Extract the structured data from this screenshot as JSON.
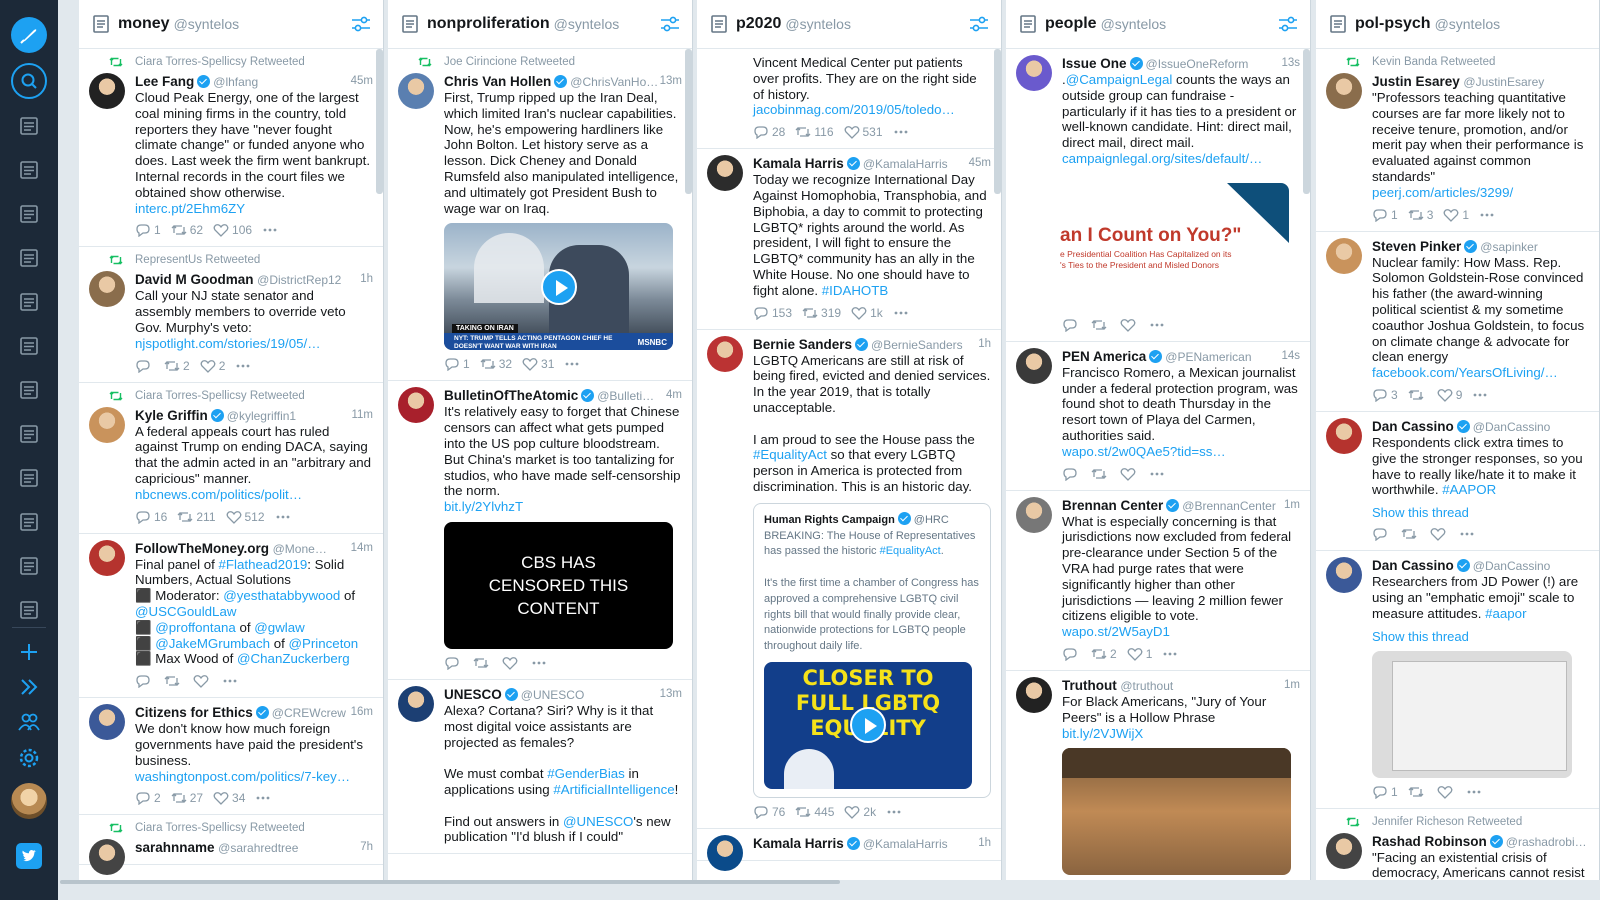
{
  "colors": {
    "accent": "#1da1f2",
    "sidebar": "#1c2938",
    "retweet": "#17bf63"
  },
  "columns": [
    {
      "num": "11",
      "name": "money",
      "account": "@syntelos",
      "tweets": [
        {
          "rt": "Ciara Torres-Spellicsy Retweeted",
          "name": "Lee Fang",
          "verified": true,
          "handle": "@lhfang",
          "time": "45m",
          "text": "Cloud Peak Energy, one of the largest coal mining firms in the country, told reporters they have \"never fought climate change\" or funded anyone who does. Last week the firm went bankrupt. Internal records in the court files we obtained show otherwise.",
          "link": "interc.pt/2Ehm6ZY",
          "replies": "1",
          "retweets": "62",
          "likes": "106"
        },
        {
          "rt": "RepresentUs Retweeted",
          "name": "David M Goodman",
          "verified": false,
          "handle": "@DistrictRep12",
          "time": "1h",
          "text": "Call your NJ state senator and assembly members to override veto Gov. Murphy's veto:",
          "link": "njspotlight.com/stories/19/05/…",
          "replies": "",
          "retweets": "2",
          "likes": "2"
        },
        {
          "rt": "Ciara Torres-Spellicsy Retweeted",
          "name": "Kyle Griffin",
          "verified": true,
          "handle": "@kylegriffin1",
          "time": "11m",
          "text": "A federal appeals court has ruled against Trump on ending DACA, saying that the admin acted in an \"arbitrary and capricious\" manner.",
          "link": "nbcnews.com/politics/polit…",
          "replies": "16",
          "retweets": "211",
          "likes": "512"
        },
        {
          "rt": "",
          "name": "FollowTheMoney.org",
          "verified": false,
          "handle": "@Mone…",
          "time": "14m",
          "text": "Final panel of #Flathead2019: Solid Numbers, Actual Solutions\n⬛ Moderator: @yesthatabbywood of @USCGouldLaw\n⬛ @proffontana of @gwlaw\n⬛ @JakeMGrumbach of @Princeton\n⬛ Max Wood of @ChanZuckerberg",
          "link": "",
          "replies": "",
          "retweets": "",
          "likes": ""
        },
        {
          "rt": "",
          "name": "Citizens for Ethics",
          "verified": true,
          "handle": "@CREWcrew",
          "time": "16m",
          "text": "We don't know how much foreign governments have paid the president's business.",
          "link": "washingtonpost.com/politics/7-key…",
          "replies": "2",
          "retweets": "27",
          "likes": "34"
        },
        {
          "rt": "Ciara Torres-Spellicsy Retweeted",
          "name": "sarahnname",
          "verified": false,
          "handle": "@sarahredtree",
          "time": "7h",
          "text": "",
          "link": "",
          "replies": "",
          "retweets": "",
          "likes": ""
        }
      ]
    },
    {
      "num": "12",
      "name": "nonproliferation",
      "account": "@syntelos",
      "tweets": [
        {
          "rt": "Joe Cirincione Retweeted",
          "name": "Chris Van Hollen",
          "verified": true,
          "handle": "@ChrisVanHo…",
          "time": "13m",
          "text": "First, Trump ripped up the Iran Deal, which limited Iran's nuclear capabilities. Now, he's empowering hardliners like John Bolton. Let history serve as a lesson. Dick Cheney and Donald Rumsfeld also manipulated intelligence, and ultimately got President Bush to wage war on Iraq.",
          "link": "",
          "media_caption": "TAKING ON IRAN",
          "media_ticker": "NYT: TRUMP TELLS ACTING PENTAGON CHIEF HE DOESN'T WANT WAR WITH IRAN",
          "media_brand": "MSNBC",
          "replies": "1",
          "retweets": "32",
          "likes": "31"
        },
        {
          "rt": "",
          "name": "BulletinOfTheAtomic",
          "verified": true,
          "handle": "@Bulleti…",
          "time": "4m",
          "text": "It's relatively easy to forget that Chinese censors can affect what gets pumped into the US pop culture bloodstream. But China's market is too tantalizing for studios, who have made self-censorship the norm.",
          "link": "bit.ly/2YlvhzT",
          "media_text": "CBS HAS CENSORED THIS CONTENT",
          "replies": "",
          "retweets": "",
          "likes": ""
        },
        {
          "rt": "",
          "name": "UNESCO",
          "verified": true,
          "handle": "@UNESCO",
          "time": "13m",
          "text": "Alexa? Cortana? Siri? Why is it that most digital voice assistants are projected as females?\n\nWe must combat #GenderBias in applications using #ArtificialIntelligence!\n\nFind out answers in @UNESCO's new publication \"I'd blush if I could\"",
          "link": "",
          "replies": "",
          "retweets": "",
          "likes": ""
        }
      ]
    },
    {
      "num": "13",
      "name": "p2020",
      "account": "@syntelos",
      "tweets": [
        {
          "rt": "",
          "name": "",
          "verified": false,
          "handle": "",
          "time": "",
          "text": "Vincent Medical Center put patients over profits. They are on the right side of history.",
          "link": "jacobinmag.com/2019/05/toledo…",
          "replies": "28",
          "retweets": "116",
          "likes": "531"
        },
        {
          "rt": "",
          "name": "Kamala Harris",
          "verified": true,
          "handle": "@KamalaHarris",
          "time": "45m",
          "text": "Today we recognize International Day Against Homophobia, Transphobia, and Biphobia, a day to commit to protecting LGBTQ* rights around the world. As president, I will fight to ensure the LGBTQ* community has an ally in the White House. No one should have to fight alone. #IDAHOTB",
          "link": "",
          "replies": "153",
          "retweets": "319",
          "likes": "1k"
        },
        {
          "rt": "",
          "name": "Bernie Sanders",
          "verified": true,
          "handle": "@BernieSanders",
          "time": "1h",
          "text": "LGBTQ Americans are still at risk of being fired, evicted and denied services. In the year 2019, that is totally unacceptable.\n\nI am proud to see the House pass the #EqualityAct so that every LGBTQ person in America is protected from discrimination. This is an historic day.",
          "link": "",
          "quote_name": "Human Rights Campaign",
          "quote_handle": "@HRC",
          "quote_text": "BREAKING: The House of Representatives has passed the historic #EqualityAct.\n\nIt's the first time a chamber of Congress has approved a comprehensive LGBTQ civil rights bill that would finally provide clear, nationwide protections for LGBTQ people throughout daily life.",
          "quote_media": "CLOSER TO FULL LGBTQ EQUALITY",
          "replies": "76",
          "retweets": "445",
          "likes": "2k"
        },
        {
          "rt": "",
          "name": "Kamala Harris",
          "verified": true,
          "handle": "@KamalaHarris",
          "time": "1h",
          "text": "",
          "link": "",
          "replies": "",
          "retweets": "",
          "likes": ""
        }
      ]
    },
    {
      "num": "14",
      "name": "people",
      "account": "@syntelos",
      "tweets": [
        {
          "rt": "",
          "name": "Issue One",
          "verified": true,
          "handle": "@IssueOneReform",
          "time": "13s",
          "text": ".@CampaignLegal counts the ways an outside group can fundraise - particularly if it has ties to a president or well-known candidate. Hint: direct mail, direct mail, direct mail.",
          "link": "campaignlegal.org/sites/default/…",
          "media_title": "an I Count on You?\"",
          "media_sub": "e Presidential Coalition Has Capitalized on its\n's Ties to the President and Misled Donors",
          "replies": "",
          "retweets": "",
          "likes": ""
        },
        {
          "rt": "",
          "name": "PEN America",
          "verified": true,
          "handle": "@PENamerican",
          "time": "14s",
          "text": "Francisco Romero, a Mexican journalist under a federal protection program, was found shot to death Thursday in the resort town of Playa del Carmen, authorities said.",
          "link": "wapo.st/2w0QAe5?tid=ss…",
          "replies": "",
          "retweets": "",
          "likes": ""
        },
        {
          "rt": "",
          "name": "Brennan Center",
          "verified": true,
          "handle": "@BrennanCenter",
          "time": "1m",
          "text": "What is especially concerning is that jurisdictions now excluded from federal pre-clearance under Section 5 of the VRA had purge rates that were significantly higher than other jurisdictions — leaving 2 million fewer citizens eligible to vote.",
          "link": "wapo.st/2W5ayD1",
          "replies": "",
          "retweets": "2",
          "likes": "1"
        },
        {
          "rt": "",
          "name": "Truthout",
          "verified": false,
          "handle": "@truthout",
          "time": "1m",
          "text": "For Black Americans, \"Jury of Your Peers\" is a Hollow Phrase",
          "link": "bit.ly/2VJWijX",
          "replies": "",
          "retweets": "",
          "likes": ""
        }
      ]
    },
    {
      "num": "15",
      "name": "pol-psych",
      "account": "@syntelos",
      "tweets": [
        {
          "rt": "Kevin Banda Retweeted",
          "name": "Justin Esarey",
          "verified": false,
          "handle": "@JustinEsarey",
          "time": "",
          "text": "\"Professors teaching quantitative courses are far more likely not to receive tenure, promotion, and/or merit pay when their performance is evaluated against common standards\"",
          "link": "peerj.com/articles/3299/",
          "replies": "1",
          "retweets": "3",
          "likes": "1"
        },
        {
          "rt": "",
          "name": "Steven Pinker",
          "verified": true,
          "handle": "@sapinker",
          "time": "",
          "text": "Nuclear family: How Mass. Rep. Solomon Goldstein-Rose convinced his father (the award-winning political scientist & my sometime coauthor Joshua Goldstein, to focus on climate change & advocate for clean energy",
          "link": "facebook.com/YearsOfLiving/…",
          "replies": "3",
          "retweets": "",
          "likes": "9"
        },
        {
          "rt": "",
          "name": "Dan Cassino",
          "verified": true,
          "handle": "@DanCassino",
          "time": "",
          "text": "Respondents click extra times to give the stronger responses, so you have to really like/hate it to make it worthwhile. #AAPOR",
          "link": "",
          "thread": "Show this thread",
          "replies": "",
          "retweets": "",
          "likes": ""
        },
        {
          "rt": "",
          "name": "Dan Cassino",
          "verified": true,
          "handle": "@DanCassino",
          "time": "",
          "text": "Researchers from JD Power (!) are using an \"emphatic emoji\" scale to measure attitudes. #aapor",
          "link": "",
          "thread": "Show this thread",
          "replies": "1",
          "retweets": "",
          "likes": ""
        },
        {
          "rt": "Jennifer Richeson Retweeted",
          "name": "Rashad Robinson",
          "verified": true,
          "handle": "@rashadrobi…",
          "time": "",
          "text": "\"Facing an existential crisis of democracy, Americans cannot resist ourselves to disenfranchisement",
          "link": "",
          "replies": "",
          "retweets": "",
          "likes": ""
        }
      ]
    }
  ]
}
